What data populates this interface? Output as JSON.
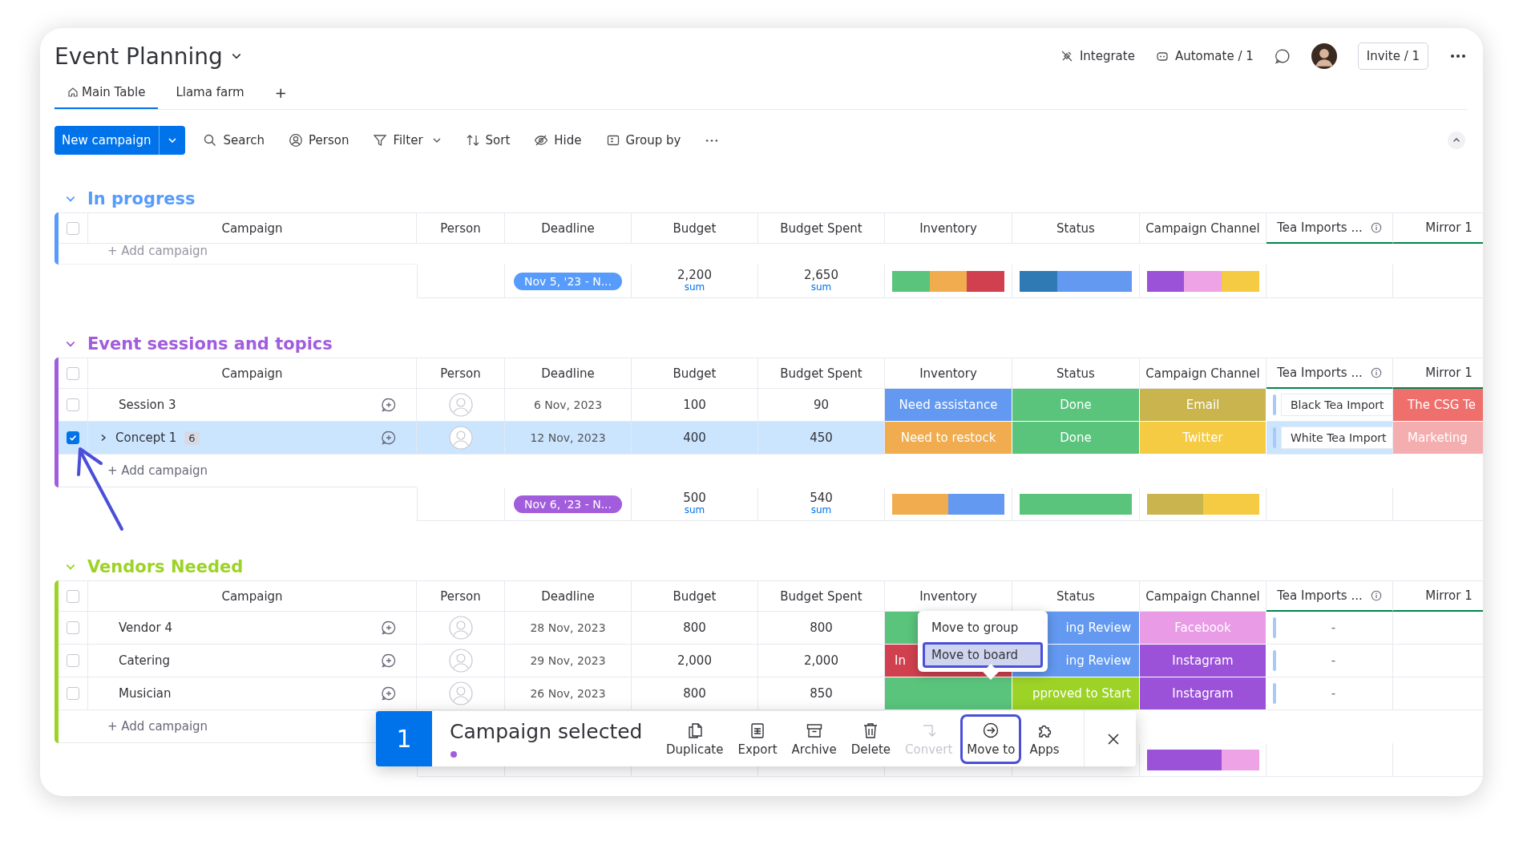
{
  "board": {
    "title": "Event Planning",
    "actions": [
      {
        "label": "Integrate",
        "kind": "integrate"
      },
      {
        "label": "Automate / 1",
        "kind": "automate"
      }
    ],
    "invite": "Invite / 1"
  },
  "tabs": [
    {
      "label": "Main Table",
      "selected": true,
      "kind": "home"
    },
    {
      "label": "Llama farm",
      "selected": false,
      "kind": "plain"
    }
  ],
  "add_tab": "+",
  "toolbar": {
    "new_button": "New campaign",
    "tools": [
      {
        "label": "Search",
        "kind": "search"
      },
      {
        "label": "Person",
        "kind": "person"
      },
      {
        "label": "Filter",
        "kind": "filter"
      },
      {
        "label": "Sort",
        "kind": "sort"
      },
      {
        "label": "Hide",
        "kind": "hide"
      },
      {
        "label": "Group by",
        "kind": "group"
      }
    ]
  },
  "groups": [
    {
      "title": "In progress",
      "color": "#579bfc",
      "columns": [
        "Campaign",
        "Person",
        "Deadline",
        "Budget",
        "Budget Spent",
        "Inventory",
        "Status",
        "Campaign Channel",
        "Tea Imports ...",
        "Mirror 1"
      ],
      "all_checked": false,
      "add_label": "+ Add campaign",
      "summary": {
        "deadline": "Nov 5, '23 - N...",
        "budget": "2,200",
        "budget_label": "sum",
        "budget_spent": "2,650",
        "budget_spent_label": "sum",
        "inventory": [
          {
            "color": "#5ac47d"
          },
          {
            "color": "#f0ac4f"
          },
          {
            "color": "#d1404f"
          }
        ],
        "status": [
          {
            "color": "#2f79b5"
          },
          {
            "color": "#6399f1"
          },
          {
            "color": "#6399f1"
          }
        ],
        "channel": [
          {
            "color": "#9b52d9"
          },
          {
            "color": "#eda3e6"
          },
          {
            "color": "#f5cb44"
          }
        ]
      }
    },
    {
      "title": "Event sessions and topics",
      "color": "#a25ddc",
      "columns": [
        "Campaign",
        "Person",
        "Deadline",
        "Budget",
        "Budget Spent",
        "Inventory",
        "Status",
        "Campaign Channel",
        "Tea Imports ...",
        "Mirror 1"
      ],
      "all_checked": false,
      "rows": [
        {
          "checked": false,
          "name": "Session 3",
          "deadline": "6 Nov, 2023",
          "budget": "100",
          "budget_spent": "90",
          "inventory": {
            "text": "Need assistance",
            "color": "#6399f1"
          },
          "status": {
            "text": "Done",
            "color": "#5ac47d"
          },
          "channel": {
            "text": "Email",
            "color": "#c9b44e"
          },
          "tea_import": "Black Tea Import",
          "mirror": {
            "text": "The CSG Te",
            "color": "#ef6f6c"
          }
        },
        {
          "checked": true,
          "name": "Concept 1",
          "count": "6",
          "deadline": "12 Nov, 2023",
          "budget": "400",
          "budget_spent": "450",
          "inventory": {
            "text": "Need to restock",
            "color": "#f0ac4f"
          },
          "status": {
            "text": "Done",
            "color": "#5ac47d"
          },
          "channel": {
            "text": "Twitter",
            "color": "#f5cb44"
          },
          "tea_import": "White Tea Import",
          "mirror": {
            "text": "Marketing",
            "color": "#f4aeb0"
          }
        }
      ],
      "add_label": "+ Add campaign",
      "summary": {
        "deadline": "Nov 6, '23 - N...",
        "budget": "500",
        "budget_label": "sum",
        "budget_spent": "540",
        "budget_spent_label": "sum",
        "inventory": [
          {
            "color": "#f0ac4f"
          },
          {
            "color": "#6399f1"
          }
        ],
        "status": [
          {
            "color": "#5ac47d"
          }
        ],
        "channel": [
          {
            "color": "#c9b44e"
          },
          {
            "color": "#f5cb44"
          }
        ]
      }
    },
    {
      "title": "Vendors Needed",
      "color": "#9cd326",
      "columns": [
        "Campaign",
        "Person",
        "Deadline",
        "Budget",
        "Budget Spent",
        "Inventory",
        "Status",
        "Campaign Channel",
        "Tea Imports ...",
        "Mirror 1"
      ],
      "all_checked": false,
      "rows": [
        {
          "checked": false,
          "name": "Vendor 4",
          "deadline": "28 Nov, 2023",
          "budget": "800",
          "budget_spent": "800",
          "inventory": {
            "color": "#5ac47d"
          },
          "status": {
            "text": "ing Review",
            "color": "#6399f1"
          },
          "channel": {
            "text": "Facebook",
            "color": "#e99be6"
          },
          "tea_import": "-"
        },
        {
          "checked": false,
          "name": "Catering",
          "deadline": "29 Nov, 2023",
          "budget": "2,000",
          "budget_spent": "2,000",
          "inventory": {
            "text": "In",
            "color": "#d1404f"
          },
          "status": {
            "text": "ing Review",
            "color": "#6399f1"
          },
          "channel": {
            "text": "Instagram",
            "color": "#9b52d9"
          },
          "tea_import": "-"
        },
        {
          "checked": false,
          "name": "Musician",
          "deadline": "26 Nov, 2023",
          "budget": "800",
          "budget_spent": "850",
          "inventory": {
            "color": "#5ac47d"
          },
          "status": {
            "text": "pproved to Start",
            "color": "#9cd326"
          },
          "channel": {
            "text": "Instagram",
            "color": "#9b52d9"
          },
          "tea_import": "-"
        }
      ],
      "add_label": "+ Add campaign",
      "summary": {
        "channel": [
          {
            "color": "#9b52d9"
          },
          {
            "color": "#9b52d9"
          },
          {
            "color": "#eda3e6"
          }
        ]
      }
    }
  ],
  "selection_bar": {
    "count": "1",
    "label": "Campaign selected",
    "actions": [
      {
        "label": "Duplicate",
        "kind": "duplicate",
        "disabled": false,
        "selected": false
      },
      {
        "label": "Export",
        "kind": "export",
        "disabled": false,
        "selected": false
      },
      {
        "label": "Archive",
        "kind": "archive",
        "disabled": false,
        "selected": false
      },
      {
        "label": "Delete",
        "kind": "delete",
        "disabled": false,
        "selected": false
      },
      {
        "label": "Convert",
        "kind": "convert",
        "disabled": true,
        "selected": false
      },
      {
        "label": "Move to",
        "kind": "move",
        "disabled": false,
        "selected": true
      },
      {
        "label": "Apps",
        "kind": "apps",
        "disabled": false,
        "selected": false
      }
    ]
  },
  "move_menu": [
    {
      "label": "Move to group",
      "selected": false
    },
    {
      "label": "Move to board",
      "selected": true
    }
  ]
}
